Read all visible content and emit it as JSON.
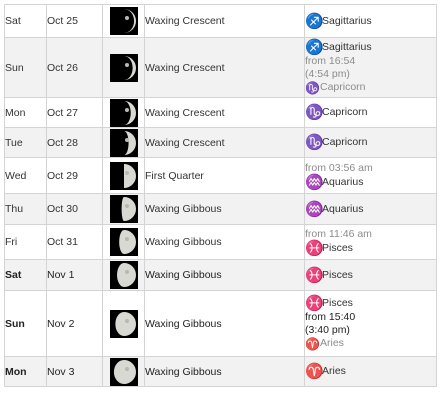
{
  "rows": [
    {
      "day": "Sat",
      "date": "Oct 25",
      "phase": "Waxing Crescent",
      "illumination": 0.08,
      "zodiac": [
        {
          "symbol": "♐",
          "symbol_name": "sagittarius-icon",
          "color": "#e03a2f",
          "sign": "Sagittarius"
        }
      ]
    },
    {
      "day": "Sun",
      "date": "Oct 26",
      "phase": "Waxing Crescent",
      "illumination": 0.14,
      "zodiac": [
        {
          "symbol": "♐",
          "symbol_name": "sagittarius-icon",
          "color": "#e03a2f",
          "sign": "Sagittarius"
        },
        {
          "from": "from 16:54",
          "paren": "(4:54 pm)"
        },
        {
          "symbol": "♑",
          "symbol_name": "capricorn-icon",
          "color": "#9a9a9a",
          "sign": "Capricorn",
          "faded": true
        }
      ]
    },
    {
      "day": "Mon",
      "date": "Oct 27",
      "phase": "Waxing Crescent",
      "illumination": 0.22,
      "zodiac": [
        {
          "symbol": "♑",
          "symbol_name": "capricorn-icon",
          "color": "#3e8a1f",
          "sign": "Capricorn"
        }
      ]
    },
    {
      "day": "Tue",
      "date": "Oct 28",
      "phase": "Waxing Crescent",
      "illumination": 0.31,
      "zodiac": [
        {
          "symbol": "♑",
          "symbol_name": "capricorn-icon",
          "color": "#3e8a1f",
          "sign": "Capricorn"
        }
      ]
    },
    {
      "day": "Wed",
      "date": "Oct 29",
      "phase": "First Quarter",
      "illumination": 0.5,
      "zodiac": [
        {
          "from": "from 03:56 am"
        },
        {
          "symbol": "♒",
          "symbol_name": "aquarius-icon",
          "color": "#e8a33d",
          "sign": "Aquarius"
        }
      ]
    },
    {
      "day": "Thu",
      "date": "Oct 30",
      "phase": "Waxing Gibbous",
      "illumination": 0.6,
      "zodiac": [
        {
          "symbol": "♒",
          "symbol_name": "aquarius-icon",
          "color": "#e8a33d",
          "sign": "Aquarius"
        }
      ]
    },
    {
      "day": "Fri",
      "date": "Oct 31",
      "phase": "Waxing Gibbous",
      "illumination": 0.7,
      "zodiac": [
        {
          "from": "from 11:46 am"
        },
        {
          "symbol": "♓",
          "symbol_name": "pisces-icon",
          "color": "#2f4fb5",
          "sign": "Pisces"
        }
      ]
    },
    {
      "day": "Sat",
      "date": "Nov 1",
      "phase": "Waxing Gibbous",
      "illumination": 0.79,
      "bold": true,
      "zodiac": [
        {
          "symbol": "♓",
          "symbol_name": "pisces-icon",
          "color": "#2f4fb5",
          "sign": "Pisces"
        }
      ]
    },
    {
      "day": "Sun",
      "date": "Nov 2",
      "phase": "Waxing Gibbous",
      "illumination": 0.86,
      "bold": true,
      "zodiac": [
        {
          "symbol": "♓",
          "symbol_name": "pisces-icon",
          "color": "#2f4fb5",
          "sign": "Pisces"
        },
        {
          "from": "from 15:40",
          "paren": "(3:40 pm)",
          "dark": true
        },
        {
          "symbol": "♈",
          "symbol_name": "aries-icon",
          "color": "#9a9a9a",
          "sign": "Aries",
          "faded": true
        }
      ]
    },
    {
      "day": "Mon",
      "date": "Nov 3",
      "phase": "Waxing Gibbous",
      "illumination": 0.92,
      "bold": true,
      "zodiac": [
        {
          "symbol": "♈",
          "symbol_name": "aries-icon",
          "color": "#d9342b",
          "sign": "Aries"
        }
      ]
    }
  ]
}
